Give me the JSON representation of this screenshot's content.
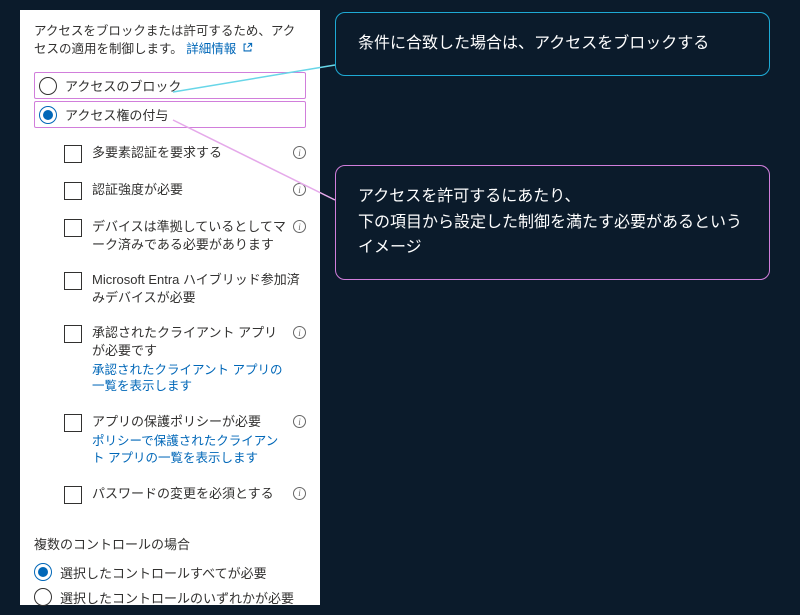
{
  "intro": {
    "text": "アクセスをブロックまたは許可するため、アクセスの適用を制御します。",
    "link_text": "詳細情報"
  },
  "radios_top": [
    {
      "label": "アクセスのブロック",
      "checked": false
    },
    {
      "label": "アクセス権の付与",
      "checked": true
    }
  ],
  "checks": [
    {
      "label": "多要素認証を要求する",
      "link": null
    },
    {
      "label": "認証強度が必要",
      "link": null
    },
    {
      "label": "デバイスは準拠しているとしてマーク済みである必要があります",
      "link": null
    },
    {
      "label": "Microsoft Entra ハイブリッド参加済みデバイスが必要",
      "link": null,
      "noicon": true
    },
    {
      "label": "承認されたクライアント アプリが必要です",
      "link": "承認されたクライアント アプリの一覧を表示します"
    },
    {
      "label": "アプリの保護ポリシーが必要",
      "link": "ポリシーで保護されたクライアント アプリの一覧を表示します"
    },
    {
      "label": "パスワードの変更を必須とする",
      "link": null
    }
  ],
  "multi": {
    "heading": "複数のコントロールの場合",
    "options": [
      {
        "label": "選択したコントロールすべてが必要",
        "checked": true
      },
      {
        "label": "選択したコントロールのいずれかが必要",
        "checked": false
      }
    ]
  },
  "callouts": {
    "c1": "条件に合致した場合は、アクセスをブロックする",
    "c2": "アクセスを許可するにあたり、\n下の項目から設定した制御を満たす必要があるというイメージ"
  }
}
